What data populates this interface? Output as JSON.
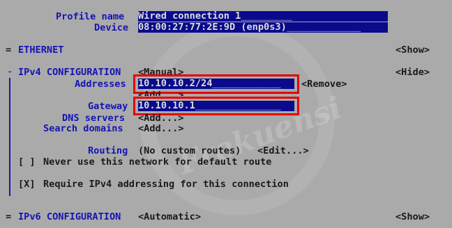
{
  "profile": {
    "name_label": "Profile name",
    "name_value": "Wired connection 1",
    "name_fill": "_________",
    "device_label": "Device",
    "device_value": "08:00:27:77:2E:9D (enp0s3)",
    "device_fill": "_____________"
  },
  "ethernet": {
    "marker": "=",
    "title": "ETHERNET",
    "show_button": "<Show>"
  },
  "ipv4": {
    "marker": "╶",
    "title": "IPv4 CONFIGURATION",
    "method": "<Manual>",
    "hide_button": "<Hide>",
    "addresses_label": "Addresses",
    "address_value": "10.10.10.2/24",
    "address_fill": "____________",
    "remove_button": "<Remove>",
    "add_address": "<Add...>",
    "gateway_label": "Gateway",
    "gateway_value": "10.10.10.1",
    "gateway_fill": "_______________",
    "dns_label": "DNS servers",
    "dns_add": "<Add...>",
    "search_label": "Search domains",
    "search_add": "<Add...>",
    "routing_label": "Routing",
    "routing_value": "(No custom routes)",
    "routing_edit": "<Edit...>",
    "never_default_check": "[ ]",
    "never_default_label": "Never use this network for default route",
    "require_check": "[X]",
    "require_label": "Require IPv4 addressing for this connection"
  },
  "ipv6": {
    "marker": "=",
    "title": "IPv6 CONFIGURATION",
    "method": "<Automatic>",
    "show_button": "<Show>"
  },
  "watermark_text": "Frekuensi",
  "colors": {
    "background": "#aaaaaa",
    "label": "#1414b4",
    "field_bg": "#0a0a8c",
    "highlight": "#e60000"
  }
}
